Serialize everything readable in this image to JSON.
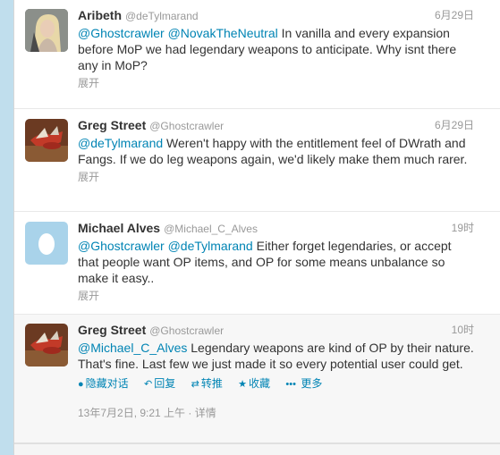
{
  "tweets": [
    {
      "fullname": "Aribeth",
      "username": "@deTylmarand",
      "time": "6月29日",
      "mentions": [
        "@Ghostcrawler",
        "@NovakTheNeutral"
      ],
      "body": " In vanilla and every expansion before MoP we had legendary weapons to anticipate. Why isnt there any in MoP?",
      "expand": "展开"
    },
    {
      "fullname": "Greg Street",
      "username": "@Ghostcrawler",
      "time": "6月29日",
      "mentions": [
        "@deTylmarand"
      ],
      "body": " Weren't happy with the entitlement feel of DWrath and Fangs. If we do leg weapons again, we'd likely make them much rarer.",
      "expand": "展开"
    },
    {
      "fullname": "Michael Alves",
      "username": "@Michael_C_Alves",
      "time": "19时",
      "mentions": [
        "@Ghostcrawler",
        "@deTylmarand"
      ],
      "body": " Either forget legendaries, or accept that people want OP items, and OP for some means unbalance so make it easy..",
      "expand": "展开"
    },
    {
      "fullname": "Greg Street",
      "username": "@Ghostcrawler",
      "time": "10时",
      "mentions": [
        "@Michael_C_Alves"
      ],
      "body": " Legendary weapons are kind of OP by their nature. That's fine. Last few we just made it so every potential user could get.",
      "actions": {
        "hide": "隐藏对话",
        "reply": "回复",
        "retweet": "转推",
        "favorite": "收藏",
        "more": "更多"
      },
      "meta": "13年7月2日, 9:21 上午 · 详情"
    }
  ]
}
